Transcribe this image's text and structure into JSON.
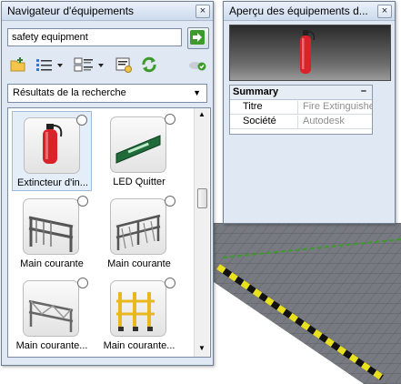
{
  "navigator": {
    "title": "Navigateur d'équipements",
    "close_label": "×",
    "search": {
      "value": "safety equipment"
    },
    "toolbar": {
      "icons": [
        "add-folder-icon",
        "list-view-icon",
        "details-view-icon",
        "properties-icon",
        "refresh-icon",
        "cloud-icon"
      ]
    },
    "results_dropdown": {
      "selected": "Résultats de la recherche"
    },
    "items": [
      {
        "label": "Extincteur d'in...",
        "icon": "fire-extinguisher-icon",
        "selected": true
      },
      {
        "label": "LED Quitter",
        "icon": "exit-sign-icon",
        "selected": false
      },
      {
        "label": "Main courante",
        "icon": "handrail-icon",
        "selected": false
      },
      {
        "label": "Main courante",
        "icon": "handrail-icon",
        "selected": false
      },
      {
        "label": "Main courante...",
        "icon": "handrail-icon",
        "selected": false
      },
      {
        "label": "Main courante...",
        "icon": "handrail-yellow-icon",
        "selected": false
      }
    ]
  },
  "preview": {
    "title": "Aperçu des équipements d...",
    "close_label": "×",
    "summary": {
      "header": "Summary",
      "collapse_symbol": "–",
      "rows": [
        {
          "key": "Titre",
          "value": "Fire Extinguishe"
        },
        {
          "key": "Société",
          "value": "Autodesk"
        }
      ]
    }
  },
  "colors": {
    "accent_green": "#3d9a2b",
    "extinguisher_red": "#d8232a",
    "floor_stripe": "#e9e01f"
  }
}
